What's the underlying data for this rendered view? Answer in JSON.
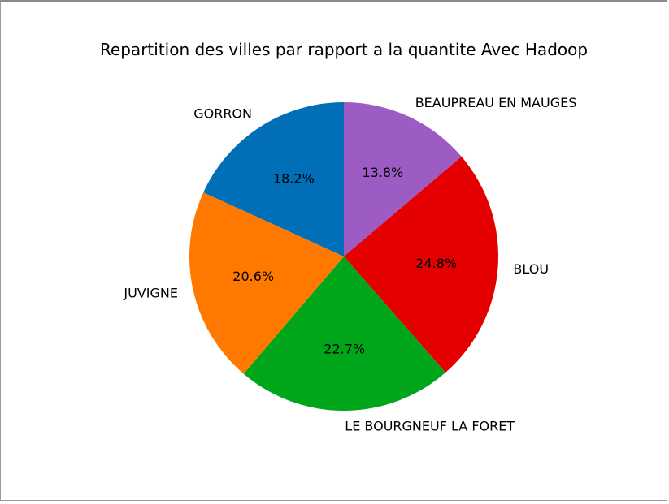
{
  "chart_data": {
    "type": "pie",
    "title": "Repartition des villes par rapport a la quantite Avec Hadoop",
    "labels": [
      "BEAUPREAU EN MAUGES",
      "BLOU",
      "LE BOURGNEUF LA FORET",
      "JUVIGNE",
      "GORRON"
    ],
    "values": [
      13.8,
      24.8,
      22.7,
      20.6,
      18.2
    ],
    "percent_labels": [
      "13.8%",
      "24.8%",
      "22.7%",
      "20.6%",
      "18.2%"
    ],
    "colors": [
      "#9c5cc4",
      "#e40000",
      "#00a619",
      "#ff7800",
      "#006fb8"
    ],
    "start_angle_deg": 90,
    "direction": "clockwise",
    "legend": "none"
  }
}
